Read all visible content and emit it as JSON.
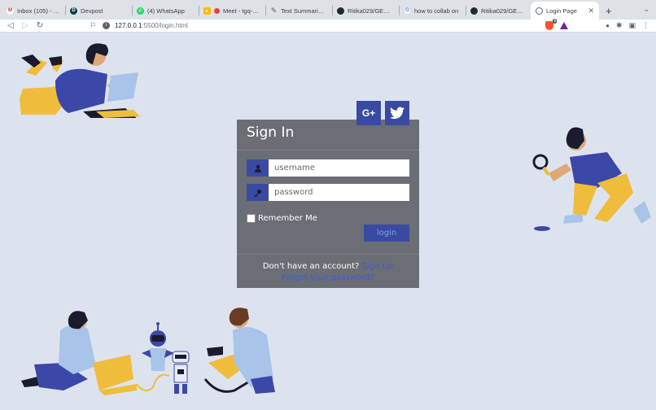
{
  "browser": {
    "tabs": [
      {
        "title": "Inbox (105) - ritika",
        "favicon": "gmail-icon",
        "color": "#d93025",
        "glyph": "M"
      },
      {
        "title": "Devpost",
        "favicon": "devpost-icon",
        "color": "#003e54",
        "glyph": "D"
      },
      {
        "title": "(4) WhatsApp",
        "favicon": "whatsapp-icon",
        "color": "#25d366",
        "glyph": "✆"
      },
      {
        "title": "Meet - tgq-xjw",
        "favicon": "meet-icon",
        "color": "#00897b",
        "glyph": "●"
      },
      {
        "title": "Text Summarizer |",
        "favicon": "pen-icon",
        "color": "#5f6368",
        "glyph": "✎"
      },
      {
        "title": "Ritika029/GENESIS",
        "favicon": "github-icon",
        "color": "#24292e",
        "glyph": "●"
      },
      {
        "title": "how to collab on",
        "favicon": "google-icon",
        "color": "#4285f4",
        "glyph": "G"
      },
      {
        "title": "Ritika029/GENESIS",
        "favicon": "github-icon",
        "color": "#24292e",
        "glyph": "●"
      },
      {
        "title": "Login Page",
        "favicon": "globe-icon",
        "color": "#5f6368",
        "glyph": "◍"
      }
    ],
    "active_tab": 8,
    "url_host": "127.0.0.1",
    "url_path": ":5500/login.html",
    "brave_count": "9"
  },
  "login": {
    "title": "Sign In",
    "social": {
      "google_label": "G+",
      "twitter_label": "twitter"
    },
    "username_placeholder": "username",
    "password_placeholder": "password",
    "remember_label": "Remember Me",
    "login_label": "login",
    "footer_text": "Don't have an account?",
    "signup_link": "Sign Up",
    "forgot_link": "Forgot your password?"
  },
  "colors": {
    "accent": "#3a4aa2",
    "card": "#6b6e75",
    "background": "#dde3ee",
    "link": "#3b5bdb",
    "illustration_yellow": "#f0bc3c",
    "illustration_blue": "#3b48a8"
  }
}
